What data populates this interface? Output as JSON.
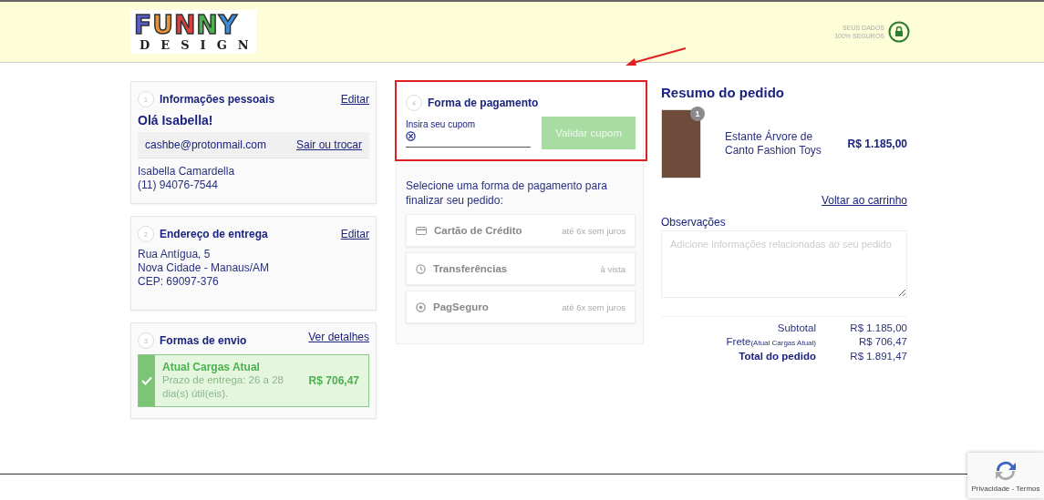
{
  "header": {
    "logo": {
      "top": "FUNNY",
      "bottom": "DESIGN"
    },
    "security": [
      "SEUS DADOS",
      "100% SEGUROS"
    ]
  },
  "personal": {
    "step": "1",
    "title": "Informações pessoais",
    "edit": "Editar",
    "greeting": "Olá Isabella!",
    "email": "cashbe@protonmail.com",
    "switch": "Sair ou trocar",
    "name": "Isabella Camardella",
    "phone": "(11) 94076-7544"
  },
  "address": {
    "step": "2",
    "title": "Endereço de entrega",
    "edit": "Editar",
    "lines": [
      "Rua Antígua, 5",
      "Nova Cidade - Manaus/AM",
      "CEP: 69097-376"
    ]
  },
  "shipping": {
    "step": "3",
    "title": "Formas de envio",
    "details": "Ver detalhes",
    "options": [
      {
        "name": "Atual Cargas Atual",
        "term": "Prazo de entrega: 26 a 28 dia(s) útil(eis).",
        "price": "R$ 706,47",
        "selected": true
      }
    ]
  },
  "payment": {
    "step": "4",
    "title": "Forma de pagamento",
    "coupon": {
      "label": "Insira seu cupom",
      "button": "Validar cupom",
      "disabled": true
    },
    "prompt": "Selecione uma forma de pagamento para finalizar seu pedido:",
    "methods": [
      {
        "kind": "card",
        "name": "Cartão de Crédito",
        "note": "até 6x sem juros"
      },
      {
        "kind": "transfer",
        "name": "Transferências",
        "note": "à vista"
      },
      {
        "kind": "pagseguro",
        "name": "PagSeguro",
        "note": "até 6x sem juros"
      }
    ]
  },
  "summary": {
    "title": "Resumo do pedido",
    "items": [
      {
        "quantity": "1",
        "name": "Estante Árvore de Canto Fashion Toys",
        "price": "R$ 1.185,00"
      }
    ],
    "back": "Voltar ao carrinho",
    "notes": {
      "label": "Observações",
      "placeholder": "Adicione informações relacionadas ao seu pedido"
    },
    "totals": [
      {
        "kind": "normal",
        "label": "Subtotal",
        "value": "R$ 1.185,00"
      },
      {
        "kind": "normal",
        "label": "Frete",
        "sublabel": "(Atual Cargas Atual)",
        "value": "R$ 706,47"
      },
      {
        "kind": "total",
        "label": "Total do pedido",
        "value": "R$ 1.891,47"
      }
    ]
  },
  "recaptcha": {
    "text": "Privacidade - Termos"
  }
}
